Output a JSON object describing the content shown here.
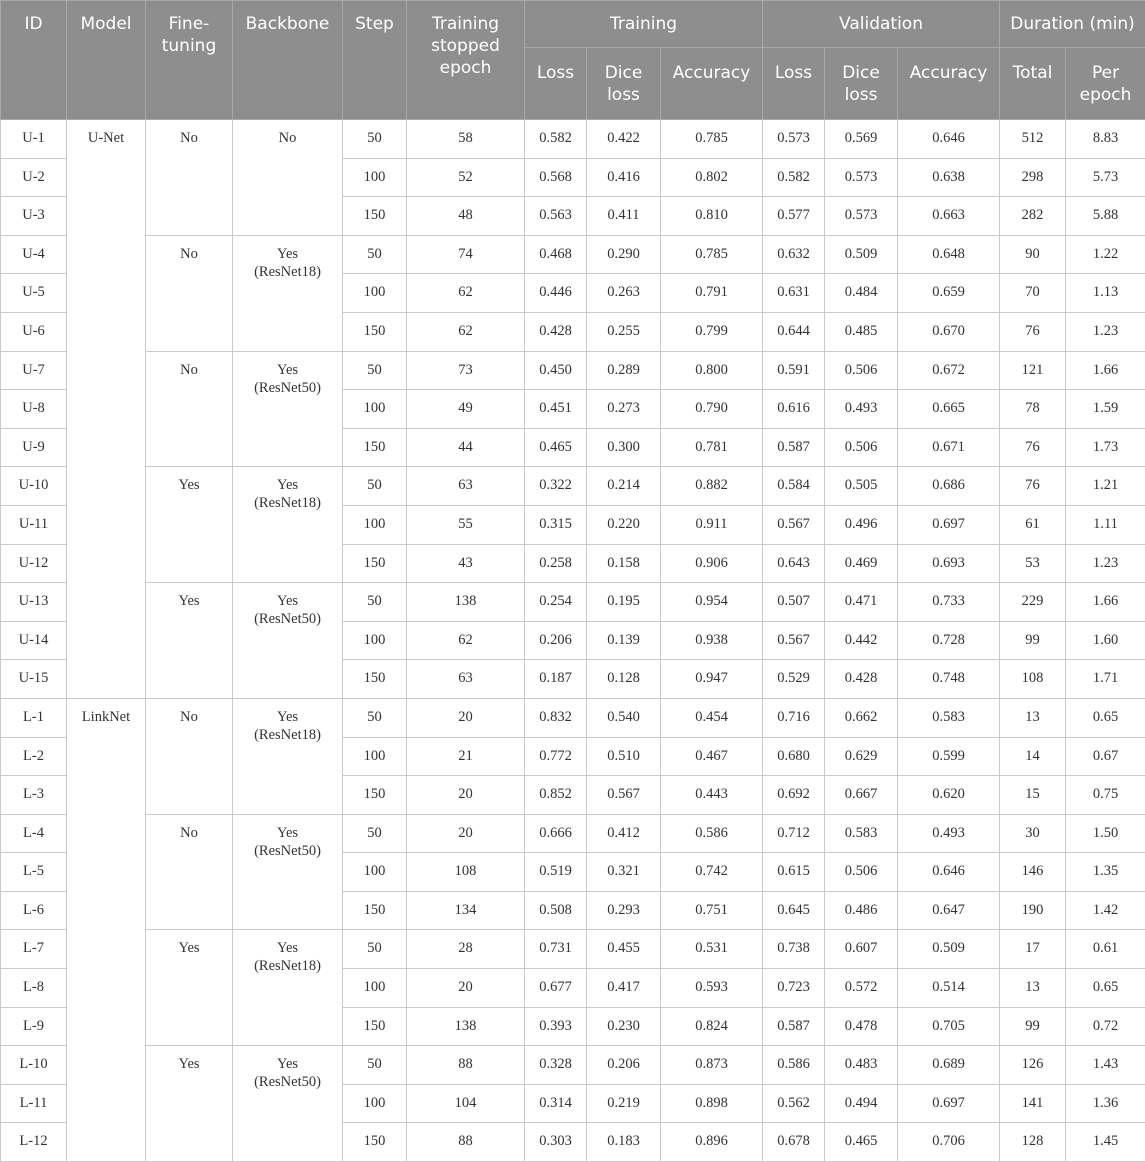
{
  "table": {
    "header": {
      "id": "ID",
      "model": "Model",
      "fine_tuning": "Fine-tuning",
      "backbone": "Backbone",
      "step": "Step",
      "stopped_epoch": "Training stopped epoch",
      "training_group": "Training",
      "validation_group": "Validation",
      "duration_group": "Duration (min)",
      "loss": "Loss",
      "dice_loss": "Dice loss",
      "accuracy": "Accuracy",
      "total": "Total",
      "per_epoch": "Per epoch"
    },
    "groups": [
      {
        "model": "U-Net",
        "configs": [
          {
            "fine_tuning": "No",
            "backbone": "No",
            "rows": [
              {
                "id": "U-1",
                "step": "50",
                "epoch": "58",
                "t_loss": "0.582",
                "t_dice": "0.422",
                "t_acc": "0.785",
                "v_loss": "0.573",
                "v_dice": "0.569",
                "v_acc": "0.646",
                "total": "512",
                "per_epoch": "8.83"
              },
              {
                "id": "U-2",
                "step": "100",
                "epoch": "52",
                "t_loss": "0.568",
                "t_dice": "0.416",
                "t_acc": "0.802",
                "v_loss": "0.582",
                "v_dice": "0.573",
                "v_acc": "0.638",
                "total": "298",
                "per_epoch": "5.73"
              },
              {
                "id": "U-3",
                "step": "150",
                "epoch": "48",
                "t_loss": "0.563",
                "t_dice": "0.411",
                "t_acc": "0.810",
                "v_loss": "0.577",
                "v_dice": "0.573",
                "v_acc": "0.663",
                "total": "282",
                "per_epoch": "5.88"
              }
            ]
          },
          {
            "fine_tuning": "No",
            "backbone": "Yes (ResNet18)",
            "rows": [
              {
                "id": "U-4",
                "step": "50",
                "epoch": "74",
                "t_loss": "0.468",
                "t_dice": "0.290",
                "t_acc": "0.785",
                "v_loss": "0.632",
                "v_dice": "0.509",
                "v_acc": "0.648",
                "total": "90",
                "per_epoch": "1.22"
              },
              {
                "id": "U-5",
                "step": "100",
                "epoch": "62",
                "t_loss": "0.446",
                "t_dice": "0.263",
                "t_acc": "0.791",
                "v_loss": "0.631",
                "v_dice": "0.484",
                "v_acc": "0.659",
                "total": "70",
                "per_epoch": "1.13"
              },
              {
                "id": "U-6",
                "step": "150",
                "epoch": "62",
                "t_loss": "0.428",
                "t_dice": "0.255",
                "t_acc": "0.799",
                "v_loss": "0.644",
                "v_dice": "0.485",
                "v_acc": "0.670",
                "total": "76",
                "per_epoch": "1.23"
              }
            ]
          },
          {
            "fine_tuning": "No",
            "backbone": "Yes (ResNet50)",
            "rows": [
              {
                "id": "U-7",
                "step": "50",
                "epoch": "73",
                "t_loss": "0.450",
                "t_dice": "0.289",
                "t_acc": "0.800",
                "v_loss": "0.591",
                "v_dice": "0.506",
                "v_acc": "0.672",
                "total": "121",
                "per_epoch": "1.66"
              },
              {
                "id": "U-8",
                "step": "100",
                "epoch": "49",
                "t_loss": "0.451",
                "t_dice": "0.273",
                "t_acc": "0.790",
                "v_loss": "0.616",
                "v_dice": "0.493",
                "v_acc": "0.665",
                "total": "78",
                "per_epoch": "1.59"
              },
              {
                "id": "U-9",
                "step": "150",
                "epoch": "44",
                "t_loss": "0.465",
                "t_dice": "0.300",
                "t_acc": "0.781",
                "v_loss": "0.587",
                "v_dice": "0.506",
                "v_acc": "0.671",
                "total": "76",
                "per_epoch": "1.73"
              }
            ]
          },
          {
            "fine_tuning": "Yes",
            "backbone": "Yes (ResNet18)",
            "rows": [
              {
                "id": "U-10",
                "step": "50",
                "epoch": "63",
                "t_loss": "0.322",
                "t_dice": "0.214",
                "t_acc": "0.882",
                "v_loss": "0.584",
                "v_dice": "0.505",
                "v_acc": "0.686",
                "total": "76",
                "per_epoch": "1.21"
              },
              {
                "id": "U-11",
                "step": "100",
                "epoch": "55",
                "t_loss": "0.315",
                "t_dice": "0.220",
                "t_acc": "0.911",
                "v_loss": "0.567",
                "v_dice": "0.496",
                "v_acc": "0.697",
                "total": "61",
                "per_epoch": "1.11"
              },
              {
                "id": "U-12",
                "step": "150",
                "epoch": "43",
                "t_loss": "0.258",
                "t_dice": "0.158",
                "t_acc": "0.906",
                "v_loss": "0.643",
                "v_dice": "0.469",
                "v_acc": "0.693",
                "total": "53",
                "per_epoch": "1.23"
              }
            ]
          },
          {
            "fine_tuning": "Yes",
            "backbone": "Yes (ResNet50)",
            "rows": [
              {
                "id": "U-13",
                "step": "50",
                "epoch": "138",
                "t_loss": "0.254",
                "t_dice": "0.195",
                "t_acc": "0.954",
                "v_loss": "0.507",
                "v_dice": "0.471",
                "v_acc": "0.733",
                "total": "229",
                "per_epoch": "1.66"
              },
              {
                "id": "U-14",
                "step": "100",
                "epoch": "62",
                "t_loss": "0.206",
                "t_dice": "0.139",
                "t_acc": "0.938",
                "v_loss": "0.567",
                "v_dice": "0.442",
                "v_acc": "0.728",
                "total": "99",
                "per_epoch": "1.60"
              },
              {
                "id": "U-15",
                "step": "150",
                "epoch": "63",
                "t_loss": "0.187",
                "t_dice": "0.128",
                "t_acc": "0.947",
                "v_loss": "0.529",
                "v_dice": "0.428",
                "v_acc": "0.748",
                "total": "108",
                "per_epoch": "1.71"
              }
            ]
          }
        ]
      },
      {
        "model": "LinkNet",
        "configs": [
          {
            "fine_tuning": "No",
            "backbone": "Yes (ResNet18)",
            "rows": [
              {
                "id": "L-1",
                "step": "50",
                "epoch": "20",
                "t_loss": "0.832",
                "t_dice": "0.540",
                "t_acc": "0.454",
                "v_loss": "0.716",
                "v_dice": "0.662",
                "v_acc": "0.583",
                "total": "13",
                "per_epoch": "0.65"
              },
              {
                "id": "L-2",
                "step": "100",
                "epoch": "21",
                "t_loss": "0.772",
                "t_dice": "0.510",
                "t_acc": "0.467",
                "v_loss": "0.680",
                "v_dice": "0.629",
                "v_acc": "0.599",
                "total": "14",
                "per_epoch": "0.67"
              },
              {
                "id": "L-3",
                "step": "150",
                "epoch": "20",
                "t_loss": "0.852",
                "t_dice": "0.567",
                "t_acc": "0.443",
                "v_loss": "0.692",
                "v_dice": "0.667",
                "v_acc": "0.620",
                "total": "15",
                "per_epoch": "0.75"
              }
            ]
          },
          {
            "fine_tuning": "No",
            "backbone": "Yes (ResNet50)",
            "rows": [
              {
                "id": "L-4",
                "step": "50",
                "epoch": "20",
                "t_loss": "0.666",
                "t_dice": "0.412",
                "t_acc": "0.586",
                "v_loss": "0.712",
                "v_dice": "0.583",
                "v_acc": "0.493",
                "total": "30",
                "per_epoch": "1.50"
              },
              {
                "id": "L-5",
                "step": "100",
                "epoch": "108",
                "t_loss": "0.519",
                "t_dice": "0.321",
                "t_acc": "0.742",
                "v_loss": "0.615",
                "v_dice": "0.506",
                "v_acc": "0.646",
                "total": "146",
                "per_epoch": "1.35"
              },
              {
                "id": "L-6",
                "step": "150",
                "epoch": "134",
                "t_loss": "0.508",
                "t_dice": "0.293",
                "t_acc": "0.751",
                "v_loss": "0.645",
                "v_dice": "0.486",
                "v_acc": "0.647",
                "total": "190",
                "per_epoch": "1.42"
              }
            ]
          },
          {
            "fine_tuning": "Yes",
            "backbone": "Yes (ResNet18)",
            "rows": [
              {
                "id": "L-7",
                "step": "50",
                "epoch": "28",
                "t_loss": "0.731",
                "t_dice": "0.455",
                "t_acc": "0.531",
                "v_loss": "0.738",
                "v_dice": "0.607",
                "v_acc": "0.509",
                "total": "17",
                "per_epoch": "0.61"
              },
              {
                "id": "L-8",
                "step": "100",
                "epoch": "20",
                "t_loss": "0.677",
                "t_dice": "0.417",
                "t_acc": "0.593",
                "v_loss": "0.723",
                "v_dice": "0.572",
                "v_acc": "0.514",
                "total": "13",
                "per_epoch": "0.65"
              },
              {
                "id": "L-9",
                "step": "150",
                "epoch": "138",
                "t_loss": "0.393",
                "t_dice": "0.230",
                "t_acc": "0.824",
                "v_loss": "0.587",
                "v_dice": "0.478",
                "v_acc": "0.705",
                "total": "99",
                "per_epoch": "0.72"
              }
            ]
          },
          {
            "fine_tuning": "Yes",
            "backbone": "Yes (ResNet50)",
            "rows": [
              {
                "id": "L-10",
                "step": "50",
                "epoch": "88",
                "t_loss": "0.328",
                "t_dice": "0.206",
                "t_acc": "0.873",
                "v_loss": "0.586",
                "v_dice": "0.483",
                "v_acc": "0.689",
                "total": "126",
                "per_epoch": "1.43"
              },
              {
                "id": "L-11",
                "step": "100",
                "epoch": "104",
                "t_loss": "0.314",
                "t_dice": "0.219",
                "t_acc": "0.898",
                "v_loss": "0.562",
                "v_dice": "0.494",
                "v_acc": "0.697",
                "total": "141",
                "per_epoch": "1.36"
              },
              {
                "id": "L-12",
                "step": "150",
                "epoch": "88",
                "t_loss": "0.303",
                "t_dice": "0.183",
                "t_acc": "0.896",
                "v_loss": "0.678",
                "v_dice": "0.465",
                "v_acc": "0.706",
                "total": "128",
                "per_epoch": "1.45"
              }
            ]
          }
        ]
      }
    ]
  },
  "colors": {
    "header_bg": "#8e8e8e",
    "header_text": "#ffffff",
    "border": "#c9c9c9",
    "body_text": "#333333"
  }
}
